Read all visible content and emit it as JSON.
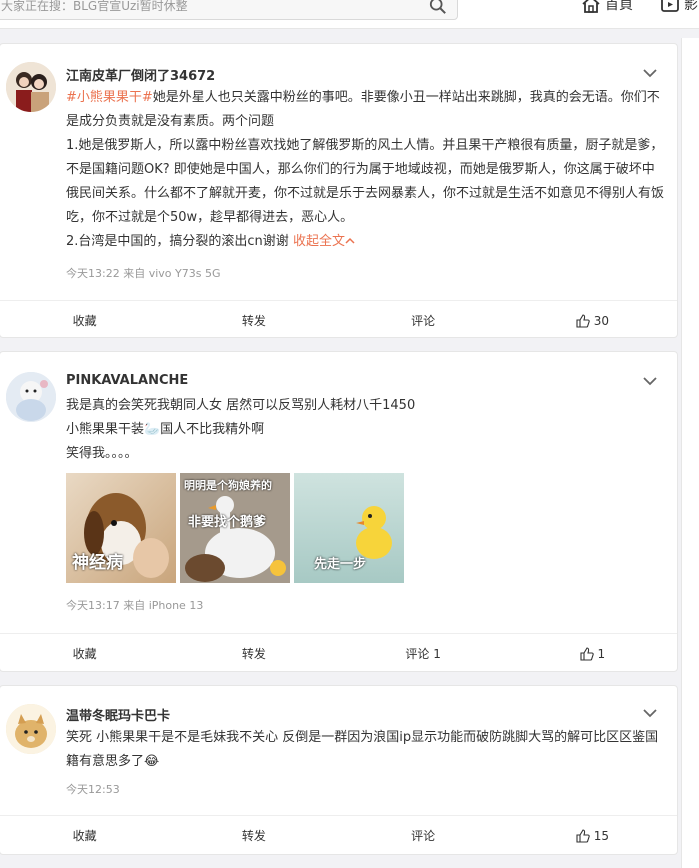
{
  "topbar": {
    "search_placeholder": "大家正在搜：BLG官宣Uzi暂时休整",
    "nav_home": "首頁",
    "nav_video": "影"
  },
  "posts": [
    {
      "username": "江南皮革厂倒闭了34672",
      "topic": "#小熊果果干#",
      "lines": [
        "她是外星人也只关露中粉丝的事吧。非要像小丑一样站出来跳脚，我真的会无语。你们不是成分负责就是没有素质。两个问题",
        "1.她是俄罗斯人，所以露中粉丝喜欢找她了解俄罗斯的风土人情。并且果干产粮很有质量，厨子就是爹，不是国籍问题OK? 即使她是中国人，那么你们的行为属于地域歧视，而她是俄罗斯人，你这属于破坏中俄民间关系。什么都不了解就开麦，你不过就是乐于去网暴素人，你不过就是生活不如意见不得别人有饭吃，你不过就是个50w，趁早都得进去，恶心人。",
        "2.台湾是中国的，搞分裂的滚出cn谢谢"
      ],
      "collapse": "收起全文",
      "meta": "今天13:22  来自 vivo Y73s 5G",
      "actions": {
        "fav": "收藏",
        "repost": "转发",
        "comment": "评论",
        "like": "30"
      }
    },
    {
      "username": "PINKAVALANCHE",
      "lines": [
        "我是真的会笑死我朝同人女 居然可以反骂别人耗材八千1450",
        "小熊果果干装🦢国人不比我精外啊",
        "笑得我。。。。"
      ],
      "images": [
        {
          "caption": "神经病"
        },
        {
          "caption_top": "明明是个狗娘养的",
          "caption": "非要找个鹅爹"
        },
        {
          "caption": "先走一步"
        }
      ],
      "meta": "今天13:17  来自 iPhone 13",
      "actions": {
        "fav": "收藏",
        "repost": "转发",
        "comment": "评论 1",
        "like": "1"
      }
    },
    {
      "username": "温带冬眠玛卡巴卡",
      "lines": [
        "笑死 小熊果果干是不是毛妹我不关心 反倒是一群因为浪国ip显示功能而破防跳脚大骂的解可比区区鉴国籍有意思多了😂"
      ],
      "meta": "今天12:53",
      "actions": {
        "fav": "收藏",
        "repost": "转发",
        "comment": "评论",
        "like": "15"
      }
    }
  ],
  "colors": {
    "accent": "#eb7350",
    "meta": "#999999",
    "bg": "#f2f2f5"
  }
}
